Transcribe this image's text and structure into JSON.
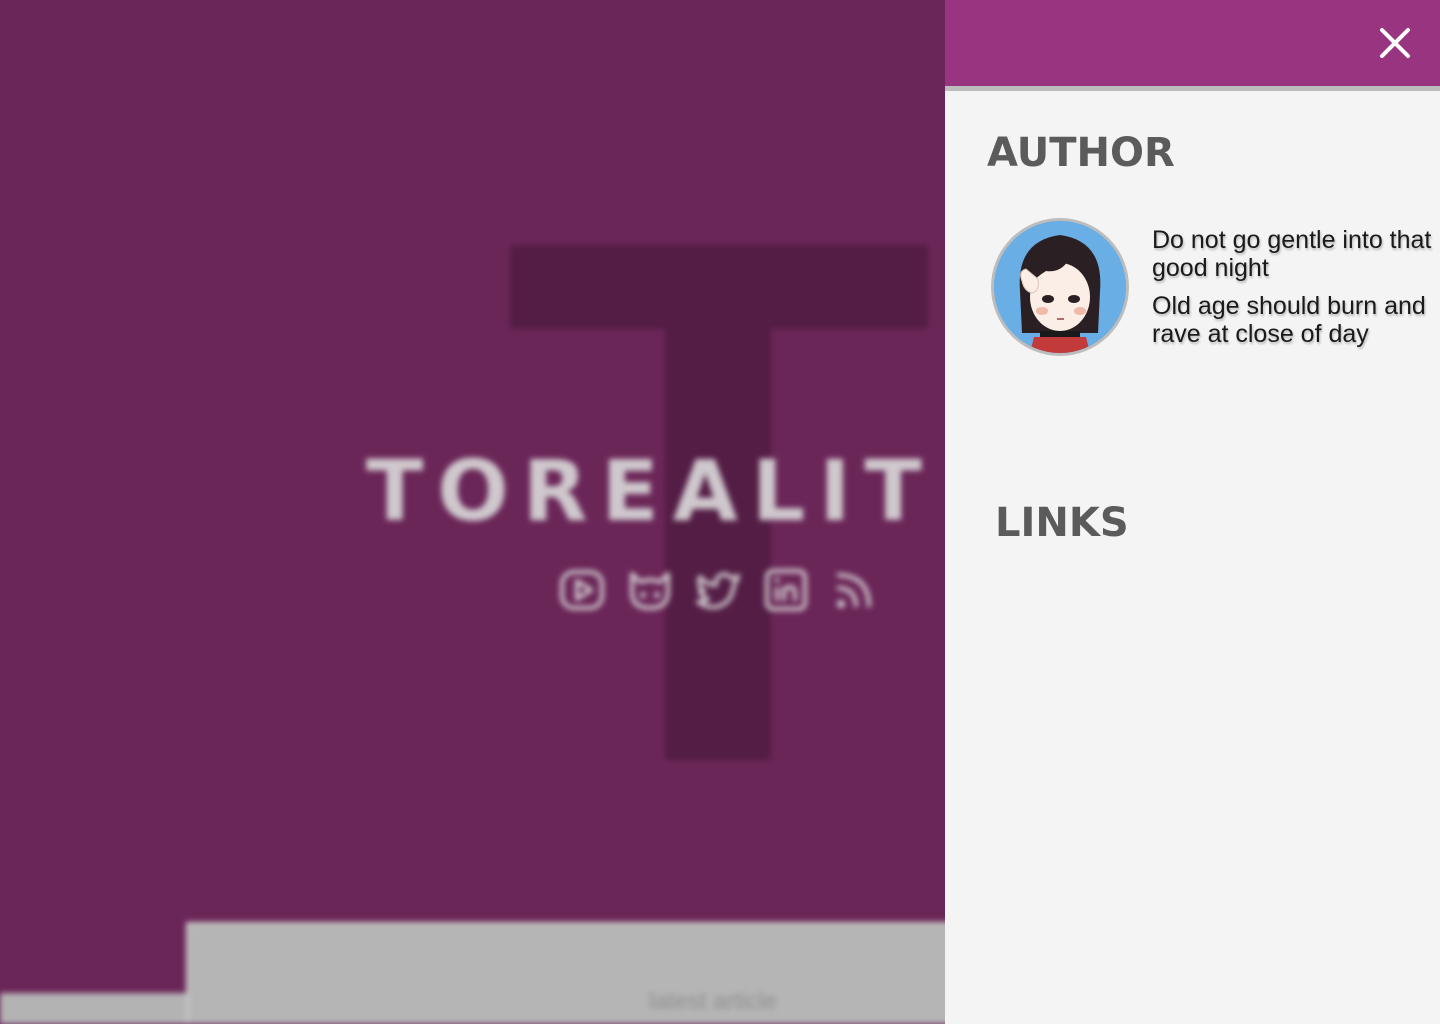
{
  "background": {
    "site_title": "TOREALIT",
    "latest_label": "latest article",
    "social_icons": [
      "youtube-icon",
      "github-icon",
      "twitter-icon",
      "linkedin-icon",
      "rss-icon"
    ],
    "hero_color": "#6b2658"
  },
  "drawer": {
    "header_color": "#993580",
    "close_icon": "close-icon",
    "author_title": "AUTHOR",
    "quote_line_1": "Do not go gentle into that good night",
    "quote_line_2": "Old age should burn and rave at close of day",
    "links_title": "LINKS"
  }
}
